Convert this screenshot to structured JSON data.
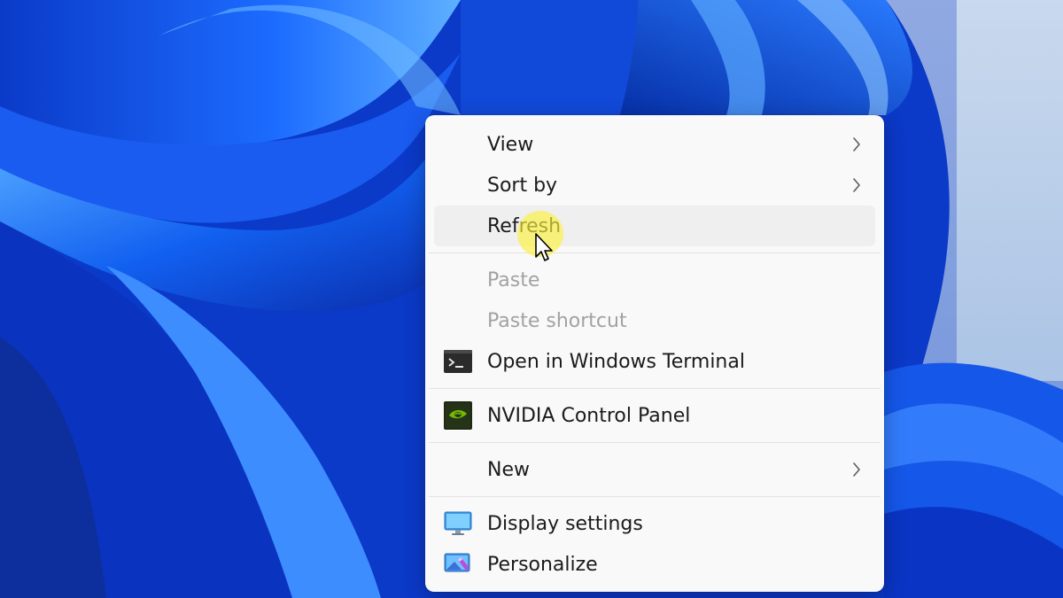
{
  "context_menu": {
    "items": [
      {
        "label": "View",
        "has_submenu": true
      },
      {
        "label": "Sort by",
        "has_submenu": true
      },
      {
        "label": "Refresh",
        "state": "hovered"
      },
      {
        "label": "Paste",
        "state": "disabled"
      },
      {
        "label": "Paste shortcut",
        "state": "disabled"
      },
      {
        "label": "Open in Windows Terminal",
        "icon": "terminal-icon"
      },
      {
        "label": "NVIDIA Control Panel",
        "icon": "nvidia-icon"
      },
      {
        "label": "New",
        "has_submenu": true
      },
      {
        "label": "Display settings",
        "icon": "display-icon"
      },
      {
        "label": "Personalize",
        "icon": "personalize-icon"
      }
    ]
  },
  "colors": {
    "wallpaper_blue": "#0b39c8",
    "menu_background": "#f9f9f9",
    "hover_background": "#efefef",
    "disabled_text": "#a2a2a2",
    "cursor_highlight": "#faf03c"
  }
}
